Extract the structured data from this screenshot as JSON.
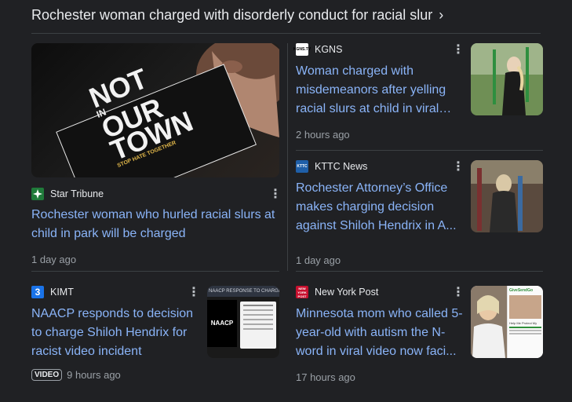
{
  "header": {
    "title": "Rochester woman charged with disorderly conduct for racial slur",
    "chevron": "chevron-right-icon"
  },
  "cards": [
    {
      "source": "Star Tribune",
      "headline": "Rochester woman who hurled racial slurs at child in park will be charged",
      "time": "1 day ago",
      "image_text": [
        "NOT",
        "IN",
        "OUR",
        "TOWN",
        "STOP HATE TOGETHER"
      ]
    },
    {
      "source": "KGNS",
      "headline": "Woman charged with misdemeanors after yelling racial slurs at child in viral video",
      "time": "2 hours ago",
      "logo_text": "KGNS.TV"
    },
    {
      "source": "KTTC News",
      "headline": "Rochester Attorney’s Office makes charging decision against Shiloh Hendrix in A...",
      "time": "1 day ago",
      "logo_text": "KTTC"
    },
    {
      "source": "KIMT",
      "headline": "NAACP responds to decision to charge Shiloh Hendrix for racist video incident",
      "time": "9 hours ago",
      "badge": "VIDEO",
      "logo_text": "3",
      "thumb_title": "NAACP RESPONSE TO CHARGING",
      "thumb_logo": "NAACP"
    },
    {
      "source": "New York Post",
      "headline": "Minnesota mom who called 5-year-old with autism the N-word in viral video now faci...",
      "time": "17 hours ago",
      "logo_text": "NEW YORK POST",
      "thumb_label": "GiveSendGo",
      "thumb_caption": "Help Me Protect My"
    }
  ]
}
